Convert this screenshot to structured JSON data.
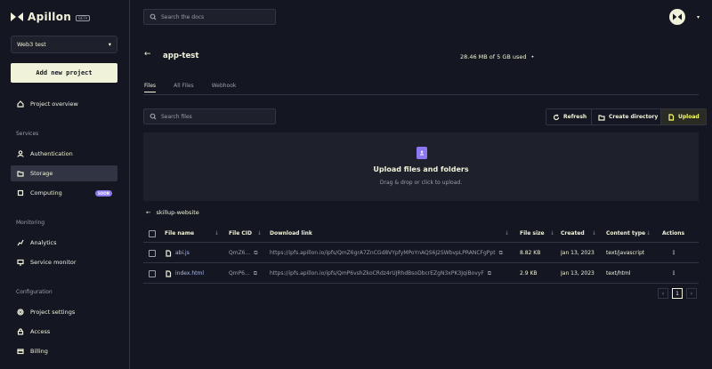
{
  "brand": {
    "name": "Apillon",
    "badge": "BETA"
  },
  "sidebar": {
    "project": "Web3 test",
    "new_project": "Add new project",
    "overview": "Project overview",
    "sections": {
      "services": "Services",
      "monitoring": "Monitoring",
      "configuration": "Configuration"
    },
    "services": [
      {
        "label": "Authentication"
      },
      {
        "label": "Storage"
      },
      {
        "label": "Computing",
        "badge": "SOON"
      }
    ],
    "monitoring": [
      {
        "label": "Analytics"
      },
      {
        "label": "Service monitor"
      }
    ],
    "configuration": [
      {
        "label": "Project settings"
      },
      {
        "label": "Access"
      },
      {
        "label": "Billing"
      }
    ]
  },
  "header": {
    "search_placeholder": "Search the docs"
  },
  "bucket": {
    "title": "app-test",
    "usage": "28.46 MB of 5 GB used"
  },
  "tabs": [
    "Files",
    "All Files",
    "Webhook"
  ],
  "toolbar": {
    "search_placeholder": "Search files",
    "refresh": "Refresh",
    "create_directory": "Create directory",
    "upload": "Upload"
  },
  "dropzone": {
    "title": "Upload files and folders",
    "subtitle": "Drag & drop or click to upload."
  },
  "folder": "skillup-website",
  "table": {
    "headers": {
      "name": "File name",
      "cid": "File CID",
      "link": "Download link",
      "size": "File size",
      "created": "Created",
      "type": "Content type",
      "actions": "Actions"
    },
    "rows": [
      {
        "name": "abi.js",
        "cid": "QmZ6...",
        "link": "https://ipfs.apillon.io/ipfs/QmZ6grA7ZnCGd8VYpfyMPoYnAQS6J2SWbvpLPRANCFgPpt",
        "size": "8.82 KB",
        "created": "Jan 13, 2023",
        "type": "text/javascript"
      },
      {
        "name": "index.html",
        "cid": "QmP6...",
        "link": "https://ipfs.apillon.io/ipfs/QmP6vshZkoCRdz4rUJRhdBsoDbcrEZgN3xPK3JqiBovyF",
        "size": "2.9 KB",
        "created": "Jan 13, 2023",
        "type": "text/html"
      }
    ]
  },
  "pagination": {
    "current": "1",
    "prev": "‹",
    "next": "›"
  },
  "colors": {
    "bg": "#141721",
    "panel": "#1e212b",
    "border": "#313442",
    "accent": "#f9ff73",
    "purple": "#8c78f0",
    "text": "#f0f2da"
  }
}
